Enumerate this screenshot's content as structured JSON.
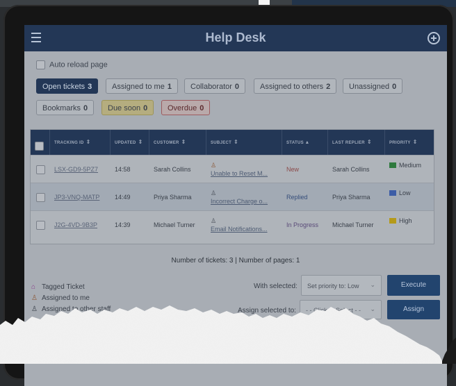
{
  "app": {
    "title": "Help Desk",
    "menu_icon": "hamburger-menu-icon",
    "add_icon": "plus-circle-icon"
  },
  "auto_reload": {
    "label": "Auto reload page",
    "checked": false
  },
  "filters": [
    {
      "label": "Open tickets",
      "count": "3",
      "active": true
    },
    {
      "label": "Assigned to me",
      "count": "1"
    },
    {
      "label": "Collaborator",
      "count": "0"
    },
    {
      "label": "Assigned to others",
      "count": "2"
    },
    {
      "label": "Unassigned",
      "count": "0"
    },
    {
      "label": "Bookmarks",
      "count": "0"
    },
    {
      "label": "Due soon",
      "count": "0"
    },
    {
      "label": "Overdue",
      "count": "0"
    }
  ],
  "table": {
    "headers": [
      "TRACKING ID",
      "UPDATED",
      "CUSTOMER",
      "SUBJECT",
      "STATUS",
      "LAST REPLIER",
      "PRIORITY"
    ],
    "rows": [
      {
        "id": "LSX-GD9-5PZ7",
        "updated": "14:58",
        "customer": "Sarah Collins",
        "subject": "Unable to Reset M...",
        "status": "New",
        "last_replier": "Sarah Collins",
        "priority": "Medium",
        "priority_color": "#2f7a3e",
        "assign_icon": "assigned-to-me-icon"
      },
      {
        "id": "JP3-VNQ-MATP",
        "updated": "14:49",
        "customer": "Priya Sharma",
        "subject": "Incorrect Charge o...",
        "status": "Replied",
        "last_replier": "Priya Sharma",
        "priority": "Low",
        "priority_color": "#3d5da6",
        "assign_icon": "assigned-to-other-icon"
      },
      {
        "id": "J2G-4VD-9B3P",
        "updated": "14:39",
        "customer": "Michael Turner",
        "subject": "Email Notifications...",
        "status": "In Progress",
        "last_replier": "Michael Turner",
        "priority": "High",
        "priority_color": "#b59a1a",
        "assign_icon": "assigned-to-other-icon"
      }
    ]
  },
  "summary": "Number of tickets: 3 | Number of pages: 1",
  "legend": {
    "tagged": "Tagged Ticket",
    "assigned_me": "Assigned to me",
    "assigned_other": "Assigned to other staff"
  },
  "bulk": {
    "with_selected_label": "With selected:",
    "priority_select": "Set priority to: Low",
    "execute": "Execute",
    "assign_selected_label": "Assign selected to:",
    "assign_select": "- - Click to Select - -",
    "assign": "Assign"
  },
  "colors": {
    "appbar": "#233756",
    "primary_button": "#22446e"
  }
}
